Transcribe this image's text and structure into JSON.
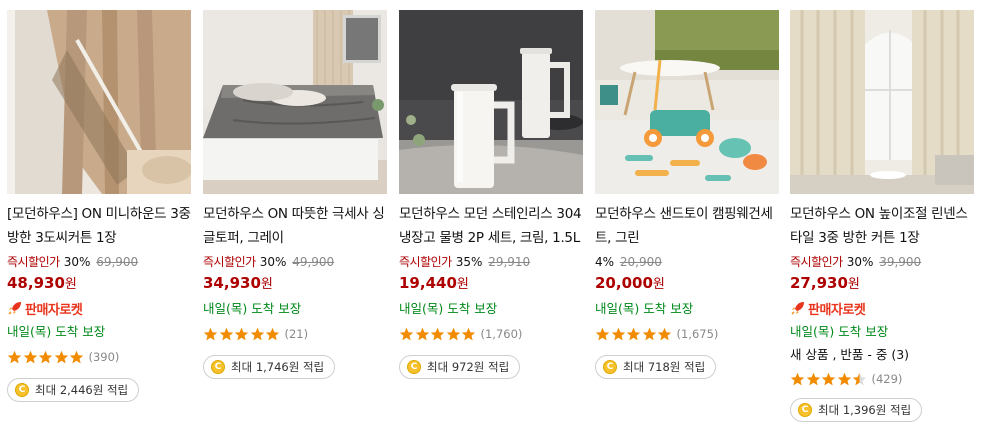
{
  "products": [
    {
      "title": "[모던하우스] ON 미니하운드 3중방한 3도씨커튼 1장",
      "discount_label": "즉시할인가",
      "discount_pct": "30%",
      "original_price": "69,900",
      "price": "48,930",
      "price_unit": "원",
      "rocket_label": "판매자로켓",
      "delivery": "내일(목) 도착 보장",
      "review_count": "(390)",
      "rating": 5,
      "cashback": "최대 2,446원 적립",
      "image": "curtain-beige"
    },
    {
      "title": "모던하우스 ON 따뜻한 극세사 싱글토퍼, 그레이",
      "discount_label": "즉시할인가",
      "discount_pct": "30%",
      "original_price": "49,900",
      "price": "34,930",
      "price_unit": "원",
      "delivery": "내일(목) 도착 보장",
      "review_count": "(21)",
      "rating": 5,
      "cashback": "최대 1,746원 적립",
      "image": "topper-gray"
    },
    {
      "title": "모던하우스 모던 스테인리스 304 냉장고 물병 2P 세트, 크림, 1.5L",
      "discount_label": "즉시할인가",
      "discount_pct": "35%",
      "original_price": "29,910",
      "price": "19,440",
      "price_unit": "원",
      "delivery": "내일(목) 도착 보장",
      "review_count": "(1,760)",
      "rating": 5,
      "cashback": "최대 972원 적립",
      "image": "water-bottles"
    },
    {
      "title": "모던하우스 샌드토이 캠핑웨건세트, 그린",
      "discount_pct": "4%",
      "original_price": "20,900",
      "price": "20,000",
      "price_unit": "원",
      "delivery": "내일(목) 도착 보장",
      "review_count": "(1,675)",
      "rating": 5,
      "cashback": "최대 718원 적립",
      "image": "sand-toy-wagon"
    },
    {
      "title": "모던하우스 ON 높이조절 린넨스타일 3중 방한 커튼 1장",
      "discount_label": "즉시할인가",
      "discount_pct": "30%",
      "original_price": "39,900",
      "price": "27,930",
      "price_unit": "원",
      "rocket_label": "판매자로켓",
      "delivery": "내일(목) 도착 보장",
      "return_info": "새 상품 , 반품 - 중 (3)",
      "review_count": "(429)",
      "rating": 4.5,
      "cashback": "최대 1,396원 적립",
      "image": "curtain-linen"
    }
  ],
  "colors": {
    "price_red": "#ae0000",
    "delivery_green": "#00891a",
    "rocket_orange": "#e8341c",
    "star_orange": "#f18b00",
    "coin_yellow": "#f7c12b"
  }
}
